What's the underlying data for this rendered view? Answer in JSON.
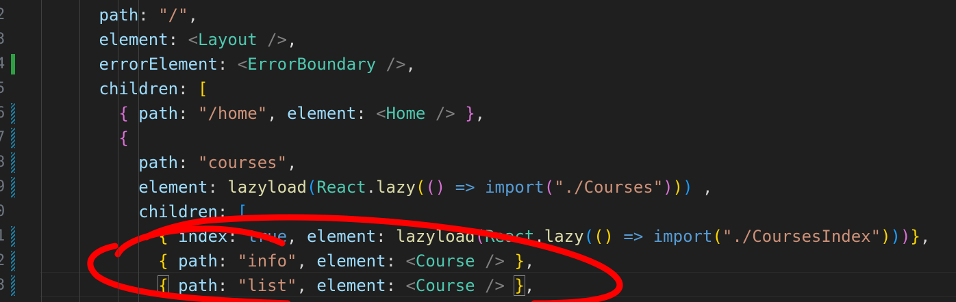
{
  "gutter": {
    "line_numbers": [
      "2",
      "3",
      "4",
      "5",
      "6",
      "7",
      "8",
      "9",
      "0",
      "1",
      "2",
      "3"
    ],
    "diff_markers": [
      "none",
      "none",
      "added",
      "none",
      "modified",
      "modified",
      "modified",
      "modified",
      "none",
      "modified",
      "modified",
      "modified"
    ]
  },
  "code": {
    "lines": [
      [
        {
          "t": "path",
          "c": "prop"
        },
        {
          "t": ": ",
          "c": "punc"
        },
        {
          "t": "\"/\"",
          "c": "str"
        },
        {
          "t": ",",
          "c": "punc"
        }
      ],
      [
        {
          "t": "element",
          "c": "prop"
        },
        {
          "t": ": ",
          "c": "punc"
        },
        {
          "t": "<",
          "c": "tagb"
        },
        {
          "t": "Layout",
          "c": "comp"
        },
        {
          "t": " />",
          "c": "tagb"
        },
        {
          "t": ",",
          "c": "punc"
        }
      ],
      [
        {
          "t": "errorElement",
          "c": "prop"
        },
        {
          "t": ": ",
          "c": "punc"
        },
        {
          "t": "<",
          "c": "tagb"
        },
        {
          "t": "ErrorBoundary",
          "c": "comp"
        },
        {
          "t": " />",
          "c": "tagb"
        },
        {
          "t": ",",
          "c": "punc"
        }
      ],
      [
        {
          "t": "children",
          "c": "prop"
        },
        {
          "t": ": ",
          "c": "punc"
        },
        {
          "t": "[",
          "c": "b1"
        }
      ],
      [
        {
          "t": "{",
          "c": "b2"
        },
        {
          "t": " ",
          "c": "punc"
        },
        {
          "t": "path",
          "c": "prop"
        },
        {
          "t": ": ",
          "c": "punc"
        },
        {
          "t": "\"/home\"",
          "c": "str"
        },
        {
          "t": ", ",
          "c": "punc"
        },
        {
          "t": "element",
          "c": "prop"
        },
        {
          "t": ": ",
          "c": "punc"
        },
        {
          "t": "<",
          "c": "tagb"
        },
        {
          "t": "Home",
          "c": "comp"
        },
        {
          "t": " />",
          "c": "tagb"
        },
        {
          "t": " ",
          "c": "punc"
        },
        {
          "t": "}",
          "c": "b2"
        },
        {
          "t": ",",
          "c": "punc"
        }
      ],
      [
        {
          "t": "{",
          "c": "b2"
        }
      ],
      [
        {
          "t": "path",
          "c": "prop"
        },
        {
          "t": ": ",
          "c": "punc"
        },
        {
          "t": "\"courses\"",
          "c": "str"
        },
        {
          "t": ",",
          "c": "punc"
        }
      ],
      [
        {
          "t": "element",
          "c": "prop"
        },
        {
          "t": ": ",
          "c": "punc"
        },
        {
          "t": "lazyload",
          "c": "fn"
        },
        {
          "t": "(",
          "c": "b3"
        },
        {
          "t": "React",
          "c": "comp"
        },
        {
          "t": ".",
          "c": "punc"
        },
        {
          "t": "lazy",
          "c": "fn"
        },
        {
          "t": "(",
          "c": "b1"
        },
        {
          "t": "()",
          "c": "b2"
        },
        {
          "t": " => ",
          "c": "kw"
        },
        {
          "t": "import",
          "c": "kw"
        },
        {
          "t": "(",
          "c": "b2"
        },
        {
          "t": "\"./Courses\"",
          "c": "str"
        },
        {
          "t": ")",
          "c": "b2"
        },
        {
          "t": ")",
          "c": "b1"
        },
        {
          "t": ")",
          "c": "b3"
        },
        {
          "t": " ,",
          "c": "punc"
        }
      ],
      [
        {
          "t": "children",
          "c": "prop"
        },
        {
          "t": ": ",
          "c": "punc"
        },
        {
          "t": "[",
          "c": "b3"
        }
      ],
      [
        {
          "t": "{",
          "c": "b1"
        },
        {
          "t": " ",
          "c": "punc"
        },
        {
          "t": "index",
          "c": "prop"
        },
        {
          "t": ": ",
          "c": "punc"
        },
        {
          "t": "true",
          "c": "kw"
        },
        {
          "t": ", ",
          "c": "punc"
        },
        {
          "t": "element",
          "c": "prop"
        },
        {
          "t": ": ",
          "c": "punc"
        },
        {
          "t": "lazyload",
          "c": "fn"
        },
        {
          "t": "(",
          "c": "b2"
        },
        {
          "t": "React",
          "c": "comp"
        },
        {
          "t": ".",
          "c": "punc"
        },
        {
          "t": "lazy",
          "c": "fn"
        },
        {
          "t": "(",
          "c": "b3"
        },
        {
          "t": "()",
          "c": "b1"
        },
        {
          "t": " => ",
          "c": "kw"
        },
        {
          "t": "import",
          "c": "kw"
        },
        {
          "t": "(",
          "c": "b1"
        },
        {
          "t": "\"./CoursesIndex\"",
          "c": "str"
        },
        {
          "t": ")",
          "c": "b1"
        },
        {
          "t": ")",
          "c": "b3"
        },
        {
          "t": ")",
          "c": "b2"
        },
        {
          "t": "}",
          "c": "b1"
        },
        {
          "t": ",",
          "c": "punc"
        }
      ],
      [
        {
          "t": "{",
          "c": "b1"
        },
        {
          "t": " ",
          "c": "punc"
        },
        {
          "t": "path",
          "c": "prop"
        },
        {
          "t": ": ",
          "c": "punc"
        },
        {
          "t": "\"info\"",
          "c": "str"
        },
        {
          "t": ", ",
          "c": "punc"
        },
        {
          "t": "element",
          "c": "prop"
        },
        {
          "t": ": ",
          "c": "punc"
        },
        {
          "t": "<",
          "c": "tagb"
        },
        {
          "t": "Course",
          "c": "comp"
        },
        {
          "t": " />",
          "c": "tagb"
        },
        {
          "t": " ",
          "c": "punc"
        },
        {
          "t": "}",
          "c": "b1"
        },
        {
          "t": ",",
          "c": "punc"
        }
      ],
      [
        {
          "t": "{",
          "c": "b1",
          "m": 1
        },
        {
          "t": " ",
          "c": "punc"
        },
        {
          "t": "path",
          "c": "prop"
        },
        {
          "t": ": ",
          "c": "punc"
        },
        {
          "t": "\"list\"",
          "c": "str"
        },
        {
          "t": ", ",
          "c": "punc"
        },
        {
          "t": "element",
          "c": "prop"
        },
        {
          "t": ": ",
          "c": "punc"
        },
        {
          "t": "<",
          "c": "tagb"
        },
        {
          "t": "Course",
          "c": "comp"
        },
        {
          "t": " />",
          "c": "tagb"
        },
        {
          "t": " ",
          "c": "punc"
        },
        {
          "t": "}",
          "c": "b1",
          "m": 1
        },
        {
          "t": ",",
          "c": "punc"
        }
      ]
    ]
  },
  "annotation": {
    "shape": "freehand-ellipse",
    "color": "#ff0000"
  },
  "colors": {
    "background": "#1f1f1f",
    "property": "#9cdcfe",
    "string": "#ce9178",
    "component": "#4ec9b0",
    "function": "#dcdcaa",
    "keyword": "#569cd6",
    "bracket_gold": "#ffd700",
    "bracket_pink": "#da70d6",
    "bracket_blue": "#179fff",
    "diff_added": "#2ea043",
    "diff_modified": "#1b81a8"
  }
}
